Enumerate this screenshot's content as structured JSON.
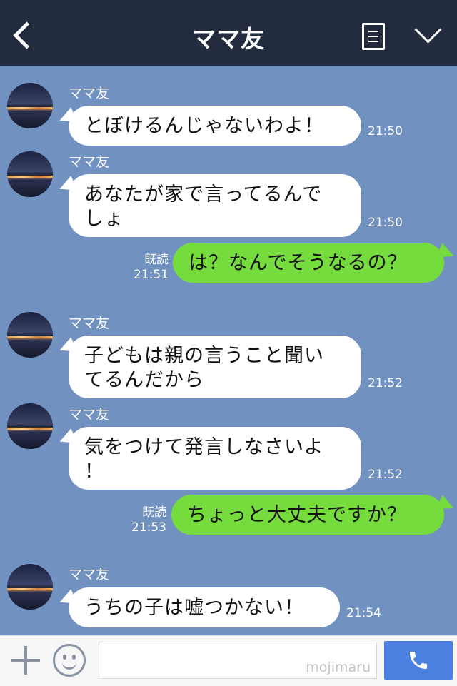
{
  "header": {
    "title": "ママ友"
  },
  "messages": [
    {
      "sender": "ママ友",
      "text": "とぼけるんじゃないわよ！",
      "time": "21:50"
    },
    {
      "sender": "ママ友",
      "line1": "あなたが家で言ってるんで",
      "line2": "しょ",
      "time": "21:50"
    },
    {
      "read": "既読",
      "time": "21:51",
      "text": "は？なんでそうなるの？"
    },
    {
      "sender": "ママ友",
      "line1": "子どもは親の言うこと聞い",
      "line2": "てるんだから",
      "time": "21:52"
    },
    {
      "sender": "ママ友",
      "line1": "気をつけて発言しなさいよ",
      "line2": "！",
      "time": "21:52"
    },
    {
      "read": "既読",
      "time": "21:53",
      "text": "ちょっと大丈夫ですか？"
    },
    {
      "sender": "ママ友",
      "text": "うちの子は嘘つかない！",
      "time": "21:54"
    }
  ],
  "footer": {
    "watermark": "mojimaru"
  },
  "colors": {
    "header_bg": "#232b3f",
    "chat_bg": "#7192c0",
    "outgoing_bubble": "#76db3c",
    "call_button": "#4b7fe0"
  }
}
